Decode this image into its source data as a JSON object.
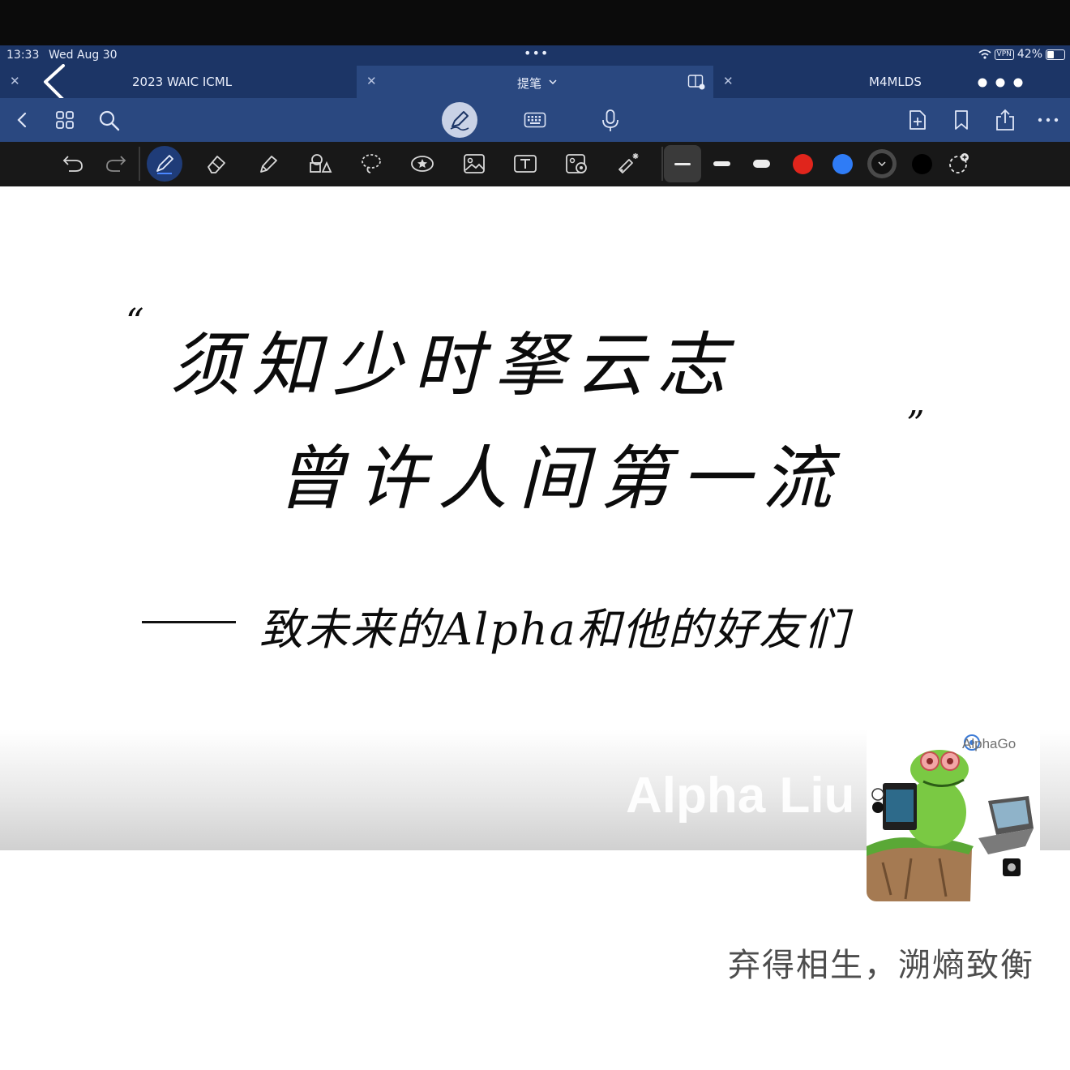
{
  "status_bar": {
    "time": "13:33",
    "date": "Wed Aug 30",
    "multitask_dots": "•••",
    "vpn": "VPN",
    "battery": "42%",
    "battery_level": 0.42
  },
  "tabs": [
    {
      "label": "2023 WAIC ICML",
      "active": false
    },
    {
      "label": "提笔",
      "active": true
    },
    {
      "label": "M4MLDS",
      "active": false
    }
  ],
  "toolbar": {
    "left": [
      "back-icon",
      "grid-icon",
      "search-icon"
    ],
    "center": [
      "pen-mode-icon",
      "keyboard-icon",
      "microphone-icon"
    ],
    "right": [
      "add-page-icon",
      "bookmark-icon",
      "share-icon",
      "more-icon"
    ]
  },
  "pen_tools": {
    "tools": [
      "undo-icon",
      "redo-icon",
      "pen-icon",
      "eraser-icon",
      "highlighter-icon",
      "shapes-icon",
      "lasso-icon",
      "sticker-icon",
      "image-icon",
      "text-icon",
      "camera-icon",
      "laser-icon"
    ],
    "selected_tool": "pen-icon",
    "stroke_widths": [
      "thin",
      "medium",
      "thick"
    ],
    "selected_width": "thin",
    "colors": [
      "#e0251c",
      "#2f7cf6",
      "#1a1a1a",
      "#000000"
    ],
    "selected_color": "#1a1a1a"
  },
  "note": {
    "open_quote": "“",
    "line1": "须知少时拏云志",
    "line2": "曾许人间第一流",
    "close_quote": "”",
    "dedication": "致未来的Alpha和他的好友们"
  },
  "overlay": {
    "watermark": "Alpha Liu",
    "sticker_brand": "AlphaGo",
    "caption": "弃得相生，溯熵致衡"
  }
}
